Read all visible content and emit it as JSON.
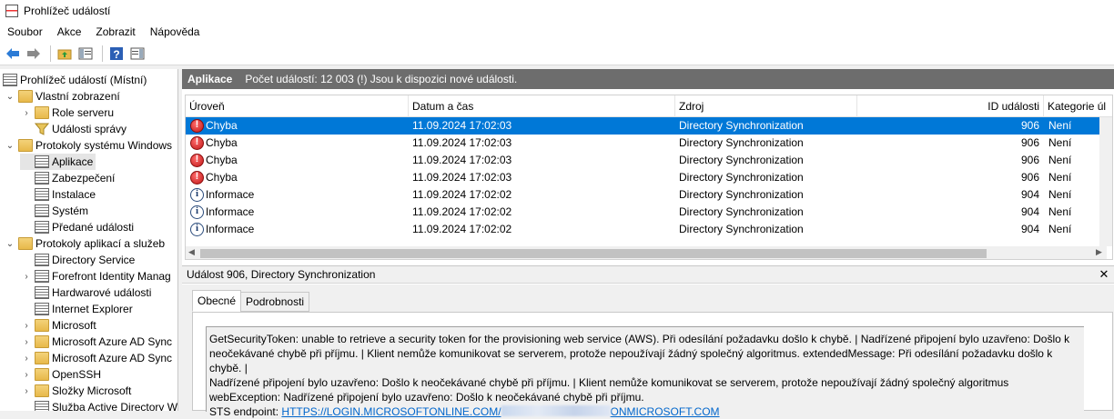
{
  "window": {
    "title": "Prohlížeč událostí"
  },
  "menu": [
    "Soubor",
    "Akce",
    "Zobrazit",
    "Nápověda"
  ],
  "tree": {
    "root": "Prohlížeč událostí (Místní)",
    "nodes": [
      {
        "label": "Vlastní zobrazení",
        "icon": "folder-icon"
      },
      {
        "label": "Role serveru",
        "icon": "folder-icon"
      },
      {
        "label": "Události správy",
        "icon": "filter-icon"
      },
      {
        "label": "Protokoly systému Windows",
        "icon": "folder-icon"
      },
      {
        "label": "Aplikace",
        "icon": "log-icon"
      },
      {
        "label": "Zabezpečení",
        "icon": "log-icon"
      },
      {
        "label": "Instalace",
        "icon": "log-icon"
      },
      {
        "label": "Systém",
        "icon": "log-icon"
      },
      {
        "label": "Předané události",
        "icon": "log-icon"
      },
      {
        "label": "Protokoly aplikací a služeb",
        "icon": "folder-icon"
      },
      {
        "label": "Directory Service",
        "icon": "log-icon"
      },
      {
        "label": "Forefront Identity Manag",
        "icon": "log-icon"
      },
      {
        "label": "Hardwarové události",
        "icon": "log-icon"
      },
      {
        "label": "Internet Explorer",
        "icon": "log-icon"
      },
      {
        "label": "Microsoft",
        "icon": "folder-icon"
      },
      {
        "label": "Microsoft Azure AD Sync",
        "icon": "folder-icon"
      },
      {
        "label": "Microsoft Azure AD Sync",
        "icon": "folder-icon"
      },
      {
        "label": "OpenSSH",
        "icon": "folder-icon"
      },
      {
        "label": "Složky Microsoft",
        "icon": "folder-icon"
      },
      {
        "label": "Služba Active Directory W",
        "icon": "log-icon"
      }
    ]
  },
  "pane": {
    "title": "Aplikace",
    "summary": "Počet událostí: 12 003 (!) Jsou k dispozici nové události."
  },
  "grid": {
    "columns": [
      "Úroveň",
      "Datum a čas",
      "Zdroj",
      "ID události",
      "Kategorie úl"
    ],
    "rows": [
      {
        "level": "Chyba",
        "date": "11.09.2024 17:02:03",
        "source": "Directory Synchronization",
        "id": "906",
        "category": "Není"
      },
      {
        "level": "Chyba",
        "date": "11.09.2024 17:02:03",
        "source": "Directory Synchronization",
        "id": "906",
        "category": "Není"
      },
      {
        "level": "Chyba",
        "date": "11.09.2024 17:02:03",
        "source": "Directory Synchronization",
        "id": "906",
        "category": "Není"
      },
      {
        "level": "Chyba",
        "date": "11.09.2024 17:02:03",
        "source": "Directory Synchronization",
        "id": "906",
        "category": "Není"
      },
      {
        "level": "Informace",
        "date": "11.09.2024 17:02:02",
        "source": "Directory Synchronization",
        "id": "904",
        "category": "Není"
      },
      {
        "level": "Informace",
        "date": "11.09.2024 17:02:02",
        "source": "Directory Synchronization",
        "id": "904",
        "category": "Není"
      },
      {
        "level": "Informace",
        "date": "11.09.2024 17:02:02",
        "source": "Directory Synchronization",
        "id": "904",
        "category": "Není"
      }
    ]
  },
  "detail": {
    "title": "Událost 906, Directory Synchronization",
    "tabs": [
      "Obecné",
      "Podrobnosti"
    ],
    "lines": [
      "GetSecurityToken: unable to retrieve a security token for the provisioning web service (AWS). Při odesílání požadavku došlo k chybě. | Nadřízené připojení bylo uzavřeno: Došlo k",
      "neočekávané chybě při příjmu. | Klient nemůže komunikovat se serverem, protože nepoužívají žádný společný algoritmus. extendedMessage: Při odesílání požadavku došlo k chybě. |",
      "Nadřízené připojení bylo uzavřeno: Došlo k neočekávané chybě při příjmu. | Klient nemůže komunikovat se serverem, protože nepoužívají žádný společný algoritmus",
      "webException: Nadřízené připojení bylo uzavřeno: Došlo k neočekávané chybě při příjmu."
    ],
    "endpoint_label": "STS endpoint:",
    "endpoint_start": "HTTPS://LOGIN.MICROSOFTONLINE.COM/",
    "endpoint_end": "ONMICROSOFT.COM"
  },
  "colors": {
    "selection": "#0078d7",
    "header_strip": "#6d6d6d",
    "link": "#0066cc"
  }
}
